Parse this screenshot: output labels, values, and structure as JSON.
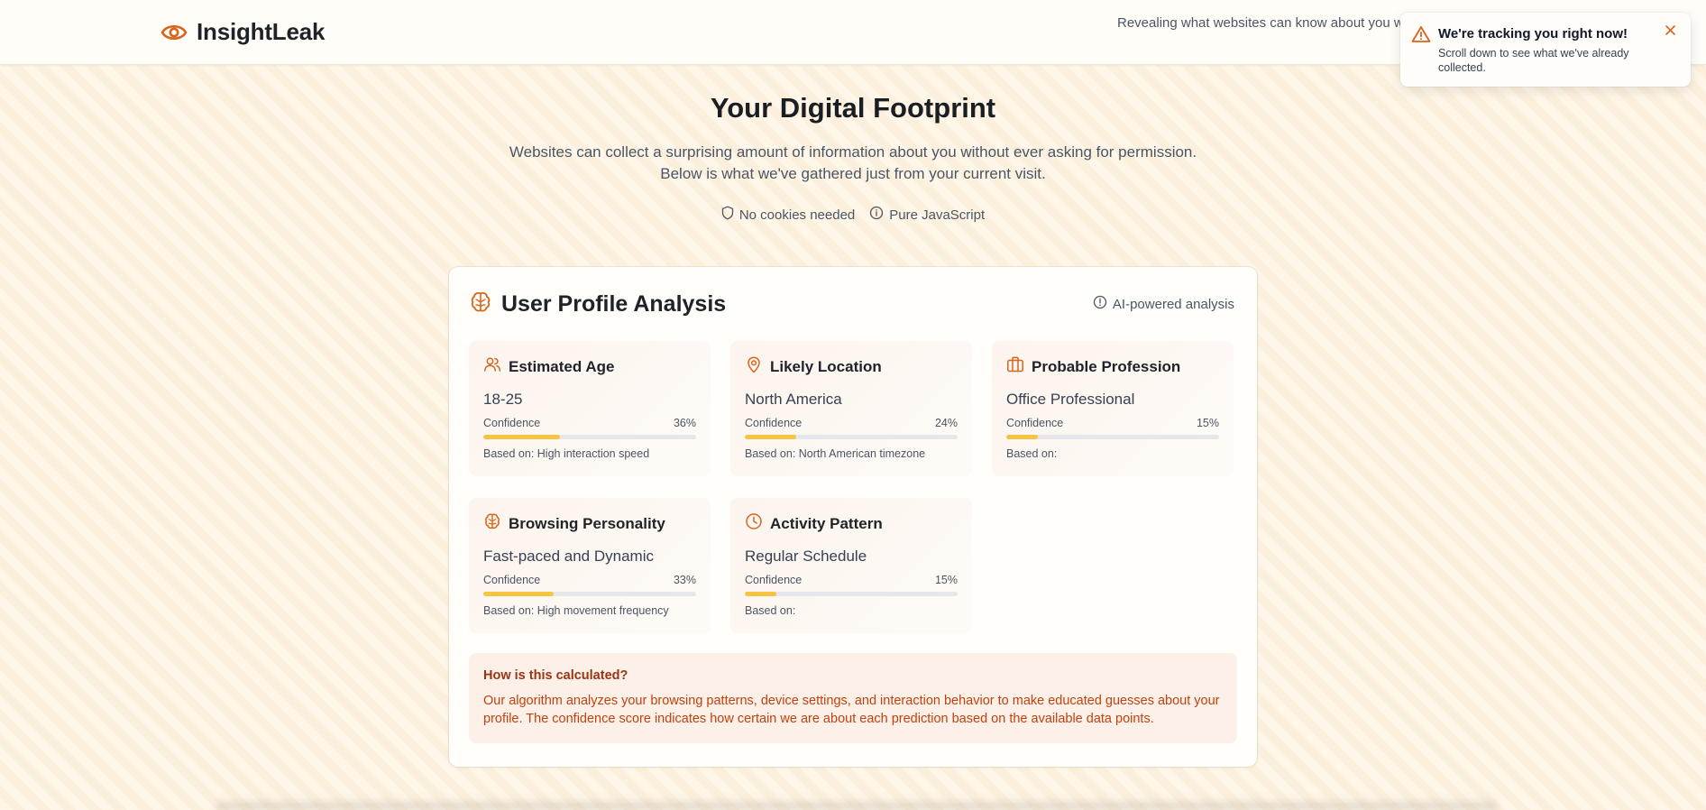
{
  "header": {
    "brand": "InsightLeak",
    "tagline": "Revealing what websites can know about you without asking"
  },
  "toast": {
    "title": "We're tracking you right now!",
    "body": "Scroll down to see what we've already collected.",
    "close_icon": "close-icon"
  },
  "hero": {
    "title": "Your Digital Footprint",
    "desc_line1": "Websites can collect a surprising amount of information about you without ever asking for permission.",
    "desc_line2": "Below is what we've gathered just from your current visit.",
    "pills": [
      {
        "label": "No cookies needed",
        "icon": "shield-icon"
      },
      {
        "label": "Pure JavaScript",
        "icon": "info-icon"
      }
    ]
  },
  "profile": {
    "title": "User Profile Analysis",
    "ai_label": "AI-powered analysis",
    "confidence_label": "Confidence",
    "cards": [
      {
        "title": "Estimated Age",
        "icon": "users-icon",
        "value": "18-25",
        "confidence": 36,
        "confidence_text": "36%",
        "basis": "Based on: High interaction speed"
      },
      {
        "title": "Likely Location",
        "icon": "map-pin-icon",
        "value": "North America",
        "confidence": 24,
        "confidence_text": "24%",
        "basis": "Based on: North American timezone"
      },
      {
        "title": "Probable Profession",
        "icon": "briefcase-icon",
        "value": "Office Professional",
        "confidence": 15,
        "confidence_text": "15%",
        "basis": "Based on:"
      },
      {
        "title": "Browsing Personality",
        "icon": "brain-icon",
        "value": "Fast-paced and Dynamic",
        "confidence": 33,
        "confidence_text": "33%",
        "basis": "Based on: High movement frequency"
      },
      {
        "title": "Activity Pattern",
        "icon": "clock-icon",
        "value": "Regular Schedule",
        "confidence": 15,
        "confidence_text": "15%",
        "basis": "Based on:"
      }
    ],
    "info": {
      "title": "How is this calculated?",
      "text": "Our algorithm analyzes your browsing patterns, device settings, and interaction behavior to make educated guesses about your profile. The confidence score indicates how certain we are about each prediction based on the available data points."
    }
  },
  "colors": {
    "accent": "#d9641a",
    "bar_fill": "#f5c542",
    "bar_track": "#e5e7eb",
    "info_text": "#c2410c"
  }
}
